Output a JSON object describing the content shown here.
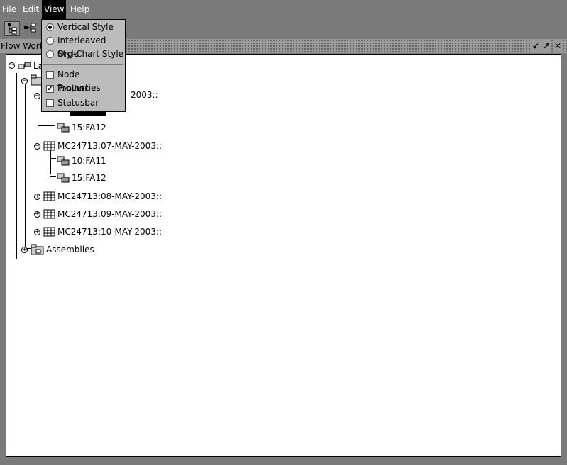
{
  "menubar": {
    "items": [
      {
        "label": "File"
      },
      {
        "label": "Edit"
      },
      {
        "label": "View"
      },
      {
        "label": "Help"
      }
    ]
  },
  "frame": {
    "title": "Flow Work",
    "controls": [
      "↙",
      "↗",
      "✕"
    ]
  },
  "tree": {
    "root_label": "La",
    "group2_label": "2003::",
    "child_1": "15:FA12",
    "group3_label": "MC24713:07-MAY-2003::",
    "group3_children": [
      "10:FA11",
      "15:FA12"
    ],
    "group4_label": "MC24713:08-MAY-2003::",
    "group5_label": "MC24713:09-MAY-2003::",
    "group6_label": "MC24713:10-MAY-2003::",
    "assemblies_label": "Assemblies"
  },
  "view_menu": {
    "vertical_style": "Vertical Style",
    "interleaved_style": "Interleaved Style",
    "org_chart_style": "Org-Chart Style",
    "node_properties": "Node Properties",
    "toolbar": "Toolbar",
    "statusbar": "Statusbar",
    "selected_style": "Vertical Style",
    "toolbar_checked": true,
    "node_properties_checked": false,
    "statusbar_checked": false
  },
  "colors": {
    "chrome": "#7a7a7a",
    "menu_bg": "#bcbcbc",
    "canvas_bg": "#ffffff",
    "active_menu": "#000000"
  }
}
